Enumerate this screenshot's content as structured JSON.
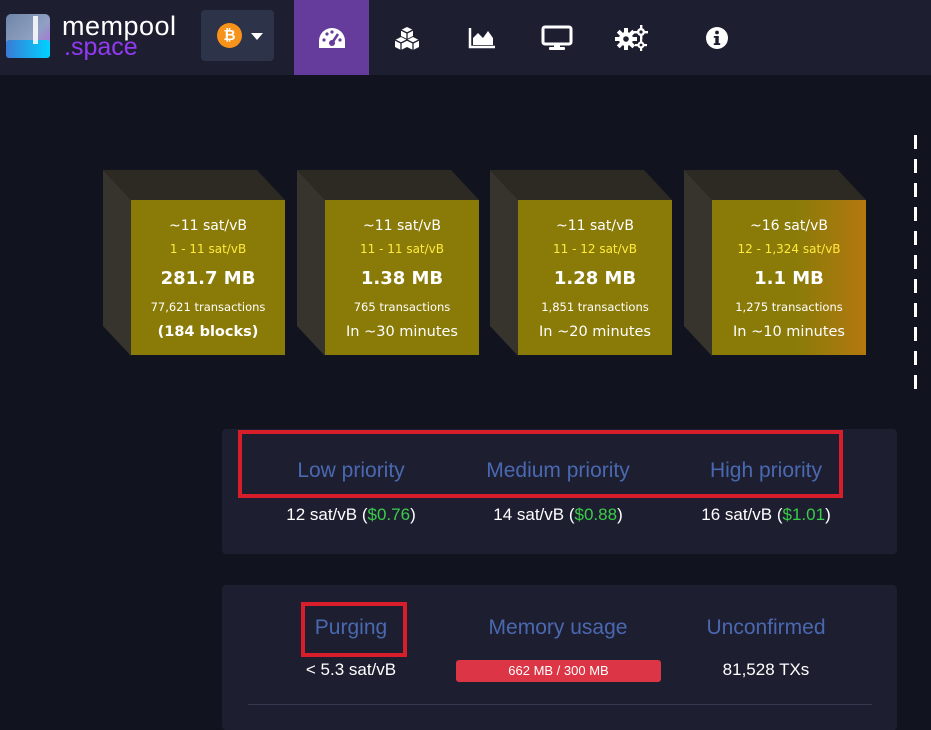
{
  "header": {
    "logo": {
      "word1": "mempool",
      "word2": ".space"
    },
    "network": {
      "symbol": "₿",
      "icon": "bitcoin-icon"
    },
    "nav": [
      {
        "name": "dashboard",
        "icon": "gauge-icon",
        "active": true
      },
      {
        "name": "blocks",
        "icon": "cubes-icon",
        "active": false
      },
      {
        "name": "graphs",
        "icon": "area-chart-icon",
        "active": false
      },
      {
        "name": "tv",
        "icon": "monitor-icon",
        "active": false
      },
      {
        "name": "api",
        "icon": "cogs-icon",
        "active": false
      },
      {
        "name": "about",
        "icon": "info-icon",
        "active": false
      }
    ]
  },
  "mempool_blocks": [
    {
      "fee": "~11 sat/vB",
      "range": "1 - 11 sat/vB",
      "size": "281.7 MB",
      "txs": "77,621 transactions",
      "time": "(184 blocks)"
    },
    {
      "fee": "~11 sat/vB",
      "range": "11 - 11 sat/vB",
      "size": "1.38 MB",
      "txs": "765 transactions",
      "time": "In ~30 minutes"
    },
    {
      "fee": "~11 sat/vB",
      "range": "11 - 12 sat/vB",
      "size": "1.28 MB",
      "txs": "1,851 transactions",
      "time": "In ~20 minutes"
    },
    {
      "fee": "~16 sat/vB",
      "range": "12 - 1,324 sat/vB",
      "size": "1.1 MB",
      "txs": "1,275 transactions",
      "time": "In ~10 minutes"
    }
  ],
  "fees": {
    "low": {
      "title": "Low priority",
      "value": "12 sat/vB (",
      "fiat": "$0.76",
      "close": ")"
    },
    "medium": {
      "title": "Medium priority",
      "value": "14 sat/vB (",
      "fiat": "$0.88",
      "close": ")"
    },
    "high": {
      "title": "High priority",
      "value": "16 sat/vB (",
      "fiat": "$1.01",
      "close": ")"
    }
  },
  "mempool_info": {
    "purging": {
      "title": "Purging",
      "value": "< 5.3 sat/vB"
    },
    "memory": {
      "title": "Memory usage",
      "value": "662 MB / 300 MB"
    },
    "unconfirmed": {
      "title": "Unconfirmed",
      "value": "81,528 TXs"
    }
  },
  "colors": {
    "background": "#11131f",
    "navbar": "#1d1f31",
    "nav_active": "#653b9c",
    "block_fill": "#8a7b09",
    "title_blue": "#4a68b0",
    "fiat_green": "#3bcc49",
    "highlight_red": "#d81e2a",
    "memory_bar": "#dc3545"
  }
}
